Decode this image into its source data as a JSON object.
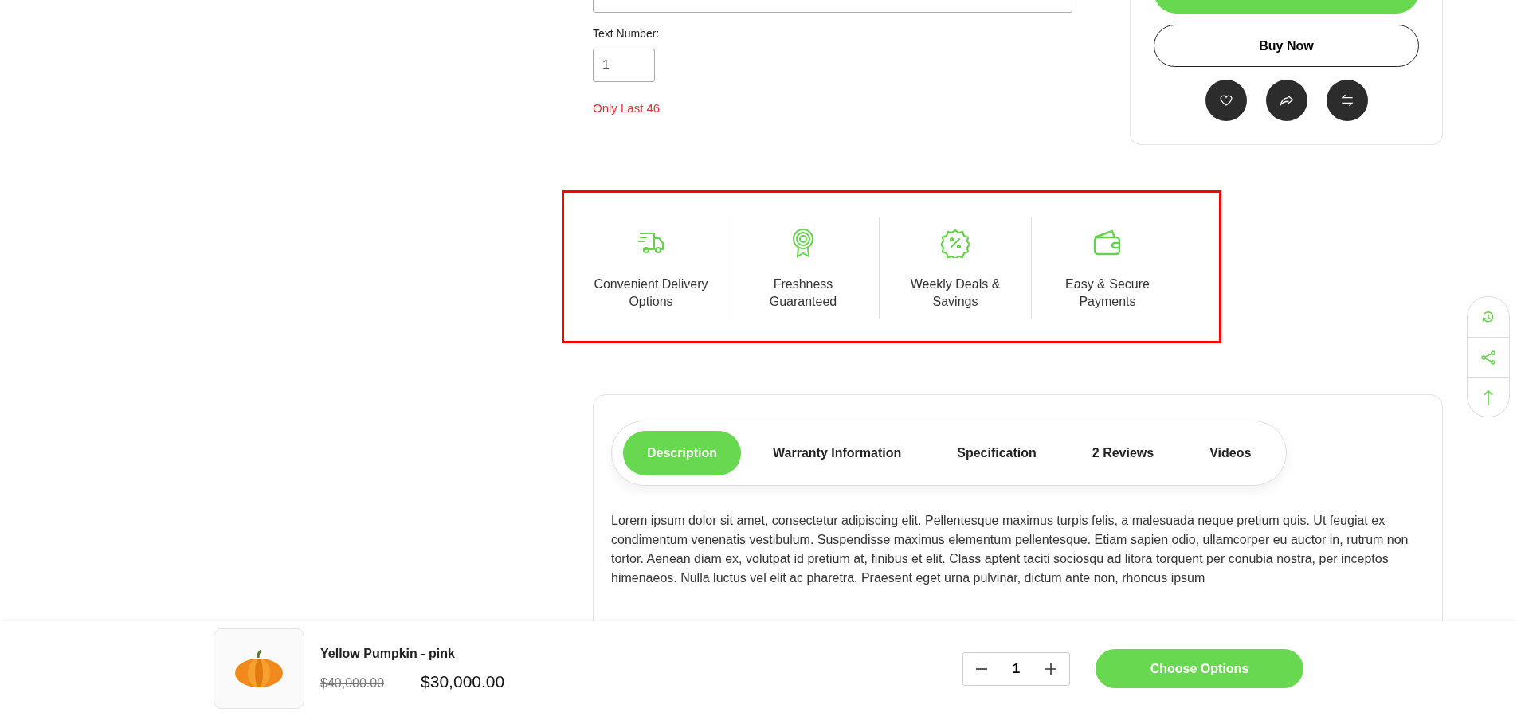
{
  "product_form": {
    "number_label": "Text Number:",
    "number_value": "1",
    "stock_note": "Only Last 46"
  },
  "purchase_card": {
    "buy_now": "Buy Now",
    "actions": [
      {
        "kind": "wishlist"
      },
      {
        "kind": "share"
      },
      {
        "kind": "compare"
      }
    ]
  },
  "features": [
    {
      "kind": "delivery",
      "label": "Convenient Delivery\nOptions"
    },
    {
      "kind": "quality",
      "label": "Freshness\nGuaranteed"
    },
    {
      "kind": "deals",
      "label": "Weekly Deals &\nSavings"
    },
    {
      "kind": "payment",
      "label": "Easy & Secure\nPayments"
    }
  ],
  "tabs": [
    {
      "label": "Description",
      "selected": true
    },
    {
      "label": "Warranty Information",
      "selected": false
    },
    {
      "label": "Specification",
      "selected": false
    },
    {
      "label": "2 Reviews",
      "selected": false
    },
    {
      "label": "Videos",
      "selected": false
    }
  ],
  "description": "Lorem ipsum dolor sit amet, consectetur adipiscing elit. Pellentesque maximus turpis felis, a malesuada neque pretium quis. Ut feugiat ex condimentum venenatis vestibulum. Suspendisse maximus elementum pellentesque. Etiam sapien odio, ullamcorper eu auctor in, rutrum non tortor. Aenean diam ex, volutpat id pretium at, finibus et elit. Class aptent taciti sociosqu ad litora torquent per conubia nostra, per inceptos himenaeos. Nulla luctus vel elit ac pharetra. Praesent eget urna pulvinar, dictum ante non, rhoncus ipsum",
  "side_tools": [
    {
      "kind": "history"
    },
    {
      "kind": "share"
    },
    {
      "kind": "top"
    }
  ],
  "sticky_bar": {
    "product": "Yellow Pumpkin - pink",
    "old_price": "$40,000.00",
    "price": "$30,000.00",
    "quantity": "1",
    "button": "Choose Options"
  }
}
